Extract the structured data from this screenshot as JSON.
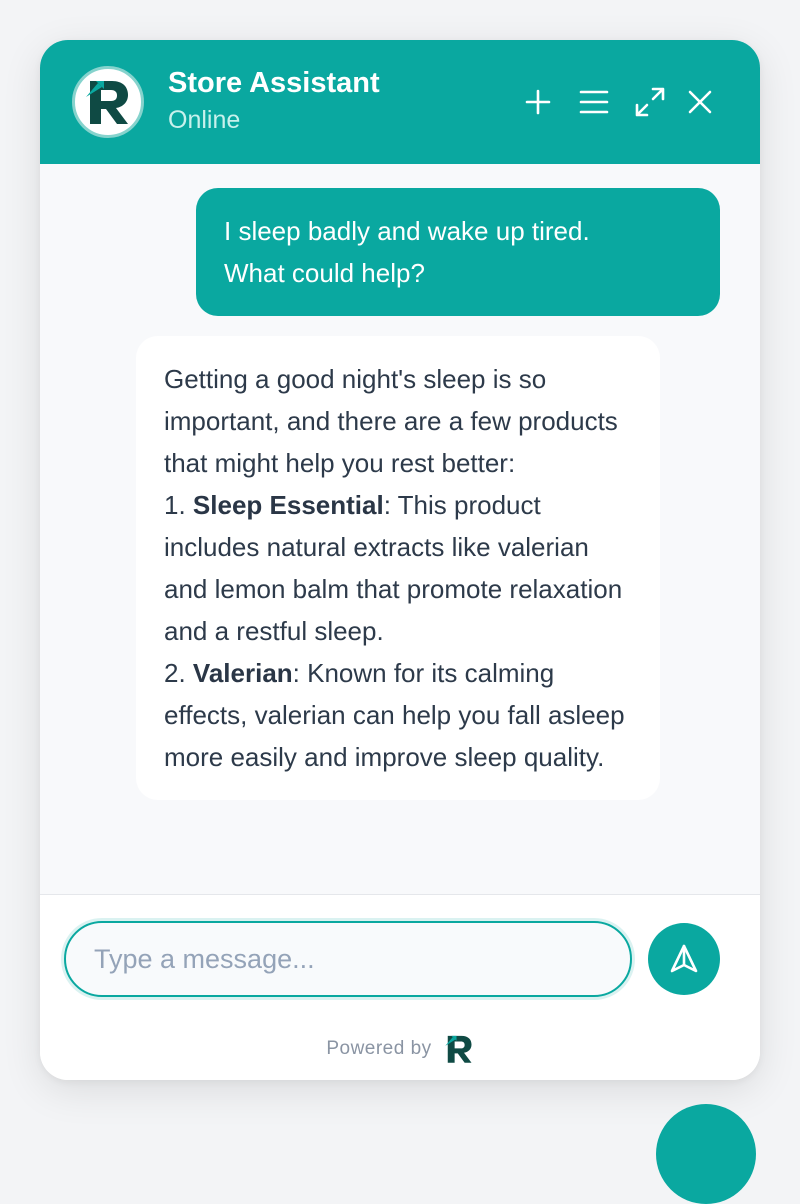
{
  "header": {
    "title": "Store Assistant",
    "status": "Online",
    "avatar_letter": "R",
    "icons": [
      "plus-icon",
      "menu-icon",
      "expand-icon",
      "close-icon"
    ]
  },
  "messages": {
    "user": {
      "line1": "I sleep badly and wake up tired.",
      "line2": "What could help?"
    },
    "bot": {
      "intro": "Getting a good night's sleep is so important, and there are a few products that might help you rest better:",
      "items": [
        {
          "prefix": "1. ",
          "name": "Sleep Essential",
          "desc": ": This product includes natural extracts like valerian and lemon balm that promote relaxation and a restful sleep."
        },
        {
          "prefix": "2. ",
          "name": "Valerian",
          "desc": ": Known for its calming effects, valerian can help you fall asleep more easily and improve sleep quality."
        }
      ]
    }
  },
  "composer": {
    "placeholder": "Type a message...",
    "value": ""
  },
  "footer": {
    "powered_by": "Powered by",
    "logo_letter": "R"
  },
  "colors": {
    "accent": "#0aa8a0",
    "header_status": "#c8f1ec",
    "text": "#2d3a4a",
    "logo_dark": "#0f4a44"
  }
}
